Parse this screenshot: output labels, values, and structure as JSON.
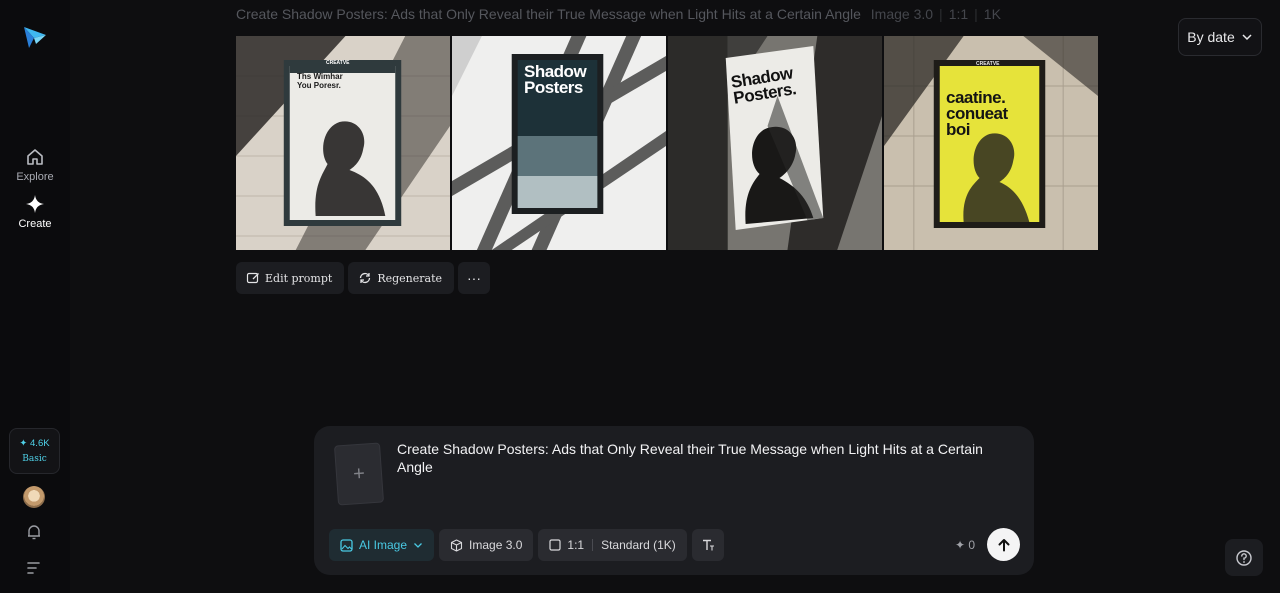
{
  "sidebar": {
    "nav": [
      {
        "label": "Explore",
        "icon": "home-icon"
      },
      {
        "label": "Create",
        "icon": "sparkle-icon"
      }
    ],
    "credits": {
      "amount": "✦ 4.6K",
      "plan": "Basic"
    },
    "icons": [
      "bell-icon",
      "menu-icon"
    ]
  },
  "header": {
    "prompt_title": "Create Shadow Posters: Ads that Only Reveal their True Message when Light Hits at a Certain Angle",
    "model": "Image 3.0",
    "ratio": "1:1",
    "resolution": "1K",
    "sort_label": "By date"
  },
  "gallery": {
    "images": [
      {
        "poster_brand": "CREATVE",
        "poster_title_1": "Ths Wimhar",
        "poster_title_2": "You Poresr."
      },
      {
        "poster_title_1": "Shadow",
        "poster_title_2": "Posters"
      },
      {
        "poster_title_1": "Shadow",
        "poster_title_2": "Posters."
      },
      {
        "poster_brand": "CREATVE",
        "poster_title_1": "caatine.",
        "poster_title_2": "conueat",
        "poster_title_3": "boi"
      }
    ]
  },
  "actions": {
    "edit": "Edit prompt",
    "regenerate": "Regenerate",
    "more": "···"
  },
  "composer": {
    "prompt": "Create Shadow Posters: Ads that Only Reveal their True Message when Light Hits at a Certain Angle",
    "upload_symbol": "+",
    "tools": {
      "ai_image": "AI Image",
      "model": "Image 3.0",
      "ratio": "1:1",
      "quality": "Standard (1K)"
    },
    "cost": "✦ 0"
  },
  "colors": {
    "accent": "#49c9e3",
    "background": "#0e0e10",
    "panel": "#1c1d21",
    "poster_yellow": "#e6e33a"
  }
}
